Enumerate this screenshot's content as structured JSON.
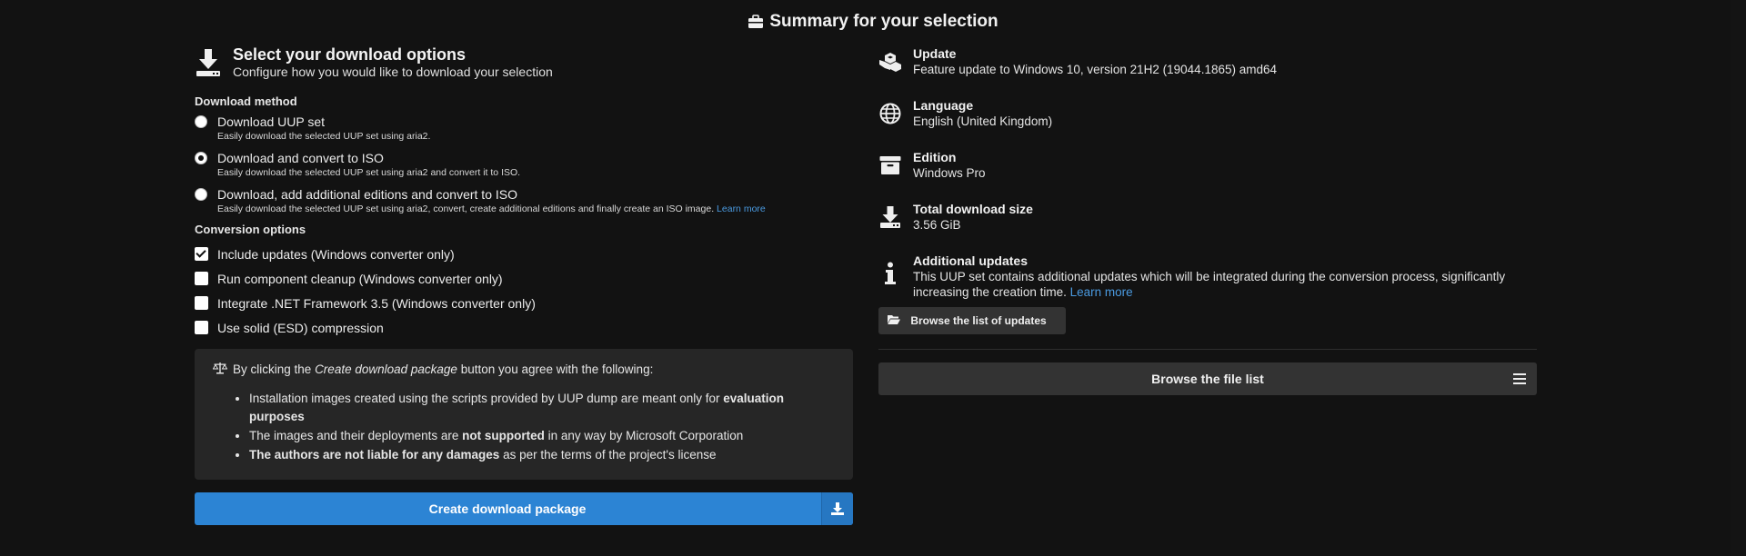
{
  "page": {
    "title": "Summary for your selection",
    "title_icon": "briefcase-icon"
  },
  "options": {
    "title": "Select your download options",
    "subtitle": "Configure how you would like to download your selection",
    "method_label": "Download method",
    "methods": [
      {
        "label": "Download UUP set",
        "desc": "Easily download the selected UUP set using aria2.",
        "selected": false
      },
      {
        "label": "Download and convert to ISO",
        "desc": "Easily download the selected UUP set using aria2 and convert it to ISO.",
        "selected": true
      },
      {
        "label": "Download, add additional editions and convert to ISO",
        "desc": "Easily download the selected UUP set using aria2, convert, create additional editions and finally create an ISO image.",
        "link": "Learn more",
        "selected": false
      }
    ],
    "conversion_label": "Conversion options",
    "conversions": [
      {
        "label": "Include updates (Windows converter only)",
        "checked": true
      },
      {
        "label": "Run component cleanup (Windows converter only)",
        "checked": false
      },
      {
        "label": "Integrate .NET Framework 3.5 (Windows converter only)",
        "checked": false
      },
      {
        "label": "Use solid (ESD) compression",
        "checked": false
      }
    ]
  },
  "agreement": {
    "prefix": "By clicking the ",
    "button_ref": "Create download package",
    "suffix": " button you agree with the following:",
    "items": [
      {
        "a": "Installation images created using the scripts provided by UUP dump are meant only for ",
        "b": "evaluation purposes",
        "c": ""
      },
      {
        "a": "The images and their deployments are ",
        "b": "not supported",
        "c": " in any way by Microsoft Corporation"
      },
      {
        "a": "",
        "b": "The authors are not liable for any damages",
        "c": " as per the terms of the project's license"
      }
    ]
  },
  "create_button": {
    "label": "Create download package",
    "icon": "download-icon"
  },
  "summary": {
    "update": {
      "title": "Update",
      "value": "Feature update to Windows 10, version 21H2 (19044.1865) amd64",
      "icon": "cubes-icon"
    },
    "language": {
      "title": "Language",
      "value": "English (United Kingdom)",
      "icon": "globe-icon"
    },
    "edition": {
      "title": "Edition",
      "value": "Windows Pro",
      "icon": "archive-icon"
    },
    "size": {
      "title": "Total download size",
      "value": "3.56 GiB",
      "icon": "download-icon"
    },
    "additional": {
      "title": "Additional updates",
      "value": "This UUP set contains additional updates which will be integrated during the conversion process, significantly increasing the creation time.",
      "link": "Learn more",
      "icon": "info-icon"
    }
  },
  "browse_updates": {
    "label": "Browse the list of updates",
    "icon": "folder-open-icon"
  },
  "browse_files": {
    "label": "Browse the file list",
    "icon": "list-icon"
  },
  "colors": {
    "accent": "#2c84d4",
    "background": "#121212",
    "panel": "#262626",
    "link": "#4a9ae0"
  }
}
